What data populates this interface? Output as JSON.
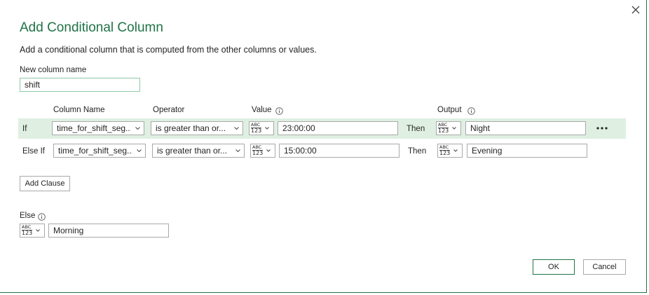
{
  "dialog": {
    "title": "Add Conditional Column",
    "subtitle": "Add a conditional column that is computed from the other columns or values.",
    "close_icon": "close-icon"
  },
  "new_column": {
    "label": "New column name",
    "value": "shift"
  },
  "headers": {
    "column_name": "Column Name",
    "operator": "Operator",
    "value": "Value",
    "output": "Output"
  },
  "clauses": [
    {
      "keyword": "If",
      "column": "time_for_shift_seg...",
      "operator": "is greater than or...",
      "value_type": {
        "top": "ABC",
        "bottom": "123"
      },
      "value": "23:00:00",
      "then": "Then",
      "output_type": {
        "top": "ABC",
        "bottom": "123"
      },
      "output": "Night",
      "highlighted": true
    },
    {
      "keyword": "Else If",
      "column": "time_for_shift_seg...",
      "operator": "is greater than or...",
      "value_type": {
        "top": "ABC",
        "bottom": "123"
      },
      "value": "15:00:00",
      "then": "Then",
      "output_type": {
        "top": "ABC",
        "bottom": "123"
      },
      "output": "Evening",
      "highlighted": false
    }
  ],
  "add_clause_label": "Add Clause",
  "else": {
    "label": "Else",
    "type": {
      "top": "ABC",
      "bottom": "123"
    },
    "value": "Morning"
  },
  "buttons": {
    "ok": "OK",
    "cancel": "Cancel"
  },
  "colors": {
    "accent": "#217346",
    "highlight_row": "#dff0e3",
    "input_border": "#a9a9a9"
  }
}
